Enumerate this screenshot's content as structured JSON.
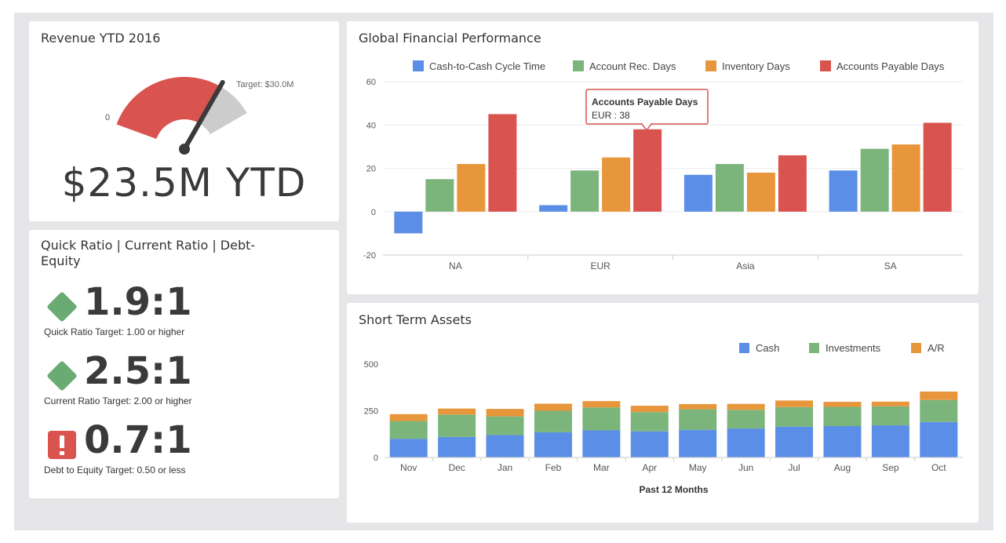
{
  "revenue": {
    "title": "Revenue YTD 2016",
    "gauge_min_label": "0",
    "gauge_target_label": "Target: $30.0M",
    "value_text": "$23.5M YTD",
    "value_fraction_of_target": 0.783,
    "colors": {
      "fill": "#d9534f",
      "remaining": "#cccccc",
      "needle": "#3a3a3a"
    }
  },
  "ratios": {
    "title": "Quick Ratio | Current Ratio | Debt-Equity",
    "items": [
      {
        "value": "1.9:1",
        "target": "Quick Ratio Target: 1.00 or higher",
        "status": "good",
        "icon": "green-diamond-icon"
      },
      {
        "value": "2.5:1",
        "target": "Current Ratio Target: 2.00 or higher",
        "status": "good",
        "icon": "green-diamond-icon"
      },
      {
        "value": "0.7:1",
        "target": "Debt to Equity Target: 0.50 or less",
        "status": "alert",
        "icon": "red-exclamation-icon"
      }
    ],
    "colors": {
      "good": "#6aab73",
      "alert": "#d9534f"
    }
  },
  "gfp": {
    "title": "Global Financial Performance",
    "tooltip": {
      "title": "Accounts Payable Days",
      "body": "EUR : 38"
    }
  },
  "sta": {
    "title": "Short Term Assets"
  },
  "chart_data": [
    {
      "type": "bar",
      "title": "Global Financial Performance",
      "categories": [
        "NA",
        "EUR",
        "Asia",
        "SA"
      ],
      "series": [
        {
          "name": "Cash-to-Cash Cycle Time",
          "color": "#5b8ee6",
          "values": [
            -10,
            3,
            17,
            19
          ]
        },
        {
          "name": "Account Rec. Days",
          "color": "#7bb57c",
          "values": [
            15,
            19,
            22,
            29
          ]
        },
        {
          "name": "Inventory Days",
          "color": "#e8963c",
          "values": [
            22,
            25,
            18,
            31
          ]
        },
        {
          "name": "Accounts Payable Days",
          "color": "#d9534f",
          "values": [
            45,
            38,
            26,
            41
          ]
        }
      ],
      "ylim": [
        -20,
        60
      ],
      "yticks": [
        "60",
        "40",
        "20",
        "0",
        "-20"
      ],
      "legend": "top",
      "grid": true
    },
    {
      "type": "bar",
      "stacked": true,
      "title": "Short Term Assets",
      "xlabel": "Past 12 Months",
      "categories": [
        "Nov",
        "Dec",
        "Jan",
        "Feb",
        "Mar",
        "Apr",
        "May",
        "Jun",
        "Jul",
        "Aug",
        "Sep",
        "Oct"
      ],
      "series": [
        {
          "name": "Cash",
          "color": "#5b8ee6",
          "values": [
            100,
            110,
            120,
            135,
            145,
            140,
            148,
            155,
            165,
            168,
            172,
            190
          ]
        },
        {
          "name": "Investments",
          "color": "#7bb57c",
          "values": [
            95,
            120,
            100,
            115,
            123,
            103,
            110,
            100,
            105,
            103,
            102,
            118
          ]
        },
        {
          "name": "A/R",
          "color": "#e8963c",
          "values": [
            37,
            32,
            40,
            38,
            34,
            34,
            28,
            32,
            35,
            27,
            25,
            45
          ]
        }
      ],
      "ylim": [
        0,
        500
      ],
      "yticks": [
        "500",
        "250",
        "0"
      ],
      "legend": "top-right",
      "grid": false
    }
  ]
}
